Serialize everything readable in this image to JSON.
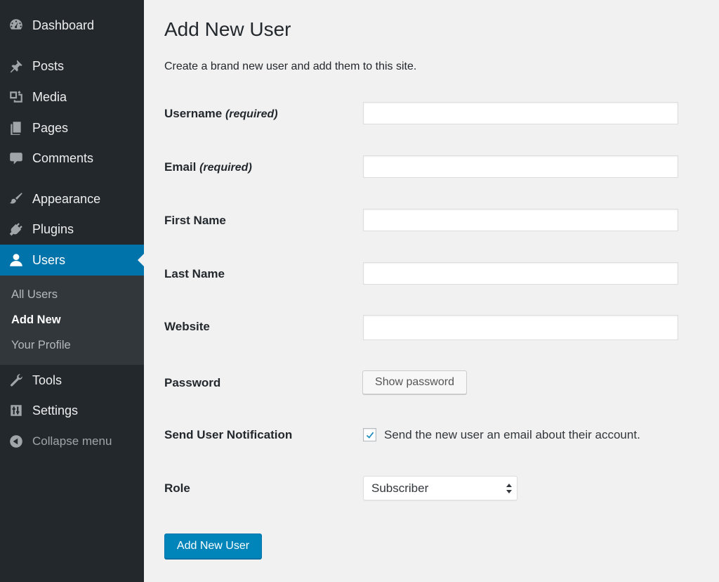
{
  "sidebar": {
    "items": [
      {
        "id": "dashboard",
        "label": "Dashboard",
        "icon": "dashboard-icon"
      },
      {
        "id": "posts",
        "label": "Posts",
        "icon": "pin-icon"
      },
      {
        "id": "media",
        "label": "Media",
        "icon": "media-icon"
      },
      {
        "id": "pages",
        "label": "Pages",
        "icon": "pages-icon"
      },
      {
        "id": "comments",
        "label": "Comments",
        "icon": "comment-icon"
      },
      {
        "id": "appearance",
        "label": "Appearance",
        "icon": "brush-icon"
      },
      {
        "id": "plugins",
        "label": "Plugins",
        "icon": "plug-icon"
      },
      {
        "id": "users",
        "label": "Users",
        "icon": "user-icon",
        "active": true
      },
      {
        "id": "tools",
        "label": "Tools",
        "icon": "wrench-icon"
      },
      {
        "id": "settings",
        "label": "Settings",
        "icon": "sliders-icon"
      }
    ],
    "submenu": [
      {
        "label": "All Users"
      },
      {
        "label": "Add New",
        "current": true
      },
      {
        "label": "Your Profile"
      }
    ],
    "collapse_label": "Collapse menu",
    "colors": {
      "background": "#23282d",
      "submenu": "#32373c",
      "active": "#0073aa"
    }
  },
  "main": {
    "title": "Add New User",
    "description": "Create a brand new user and add them to this site.",
    "fields": {
      "username": {
        "label": "Username",
        "note": "(required)",
        "value": ""
      },
      "email": {
        "label": "Email",
        "note": "(required)",
        "value": ""
      },
      "first_name": {
        "label": "First Name",
        "value": ""
      },
      "last_name": {
        "label": "Last Name",
        "value": ""
      },
      "website": {
        "label": "Website",
        "value": ""
      }
    },
    "password": {
      "label": "Password",
      "button": "Show password"
    },
    "notification": {
      "label": "Send User Notification",
      "checked": true,
      "text": "Send the new user an email about their account."
    },
    "role": {
      "label": "Role",
      "selected": "Subscriber"
    },
    "submit_label": "Add New User",
    "colors": {
      "primary": "#0085ba",
      "checkmark": "#1e8cbe"
    }
  }
}
